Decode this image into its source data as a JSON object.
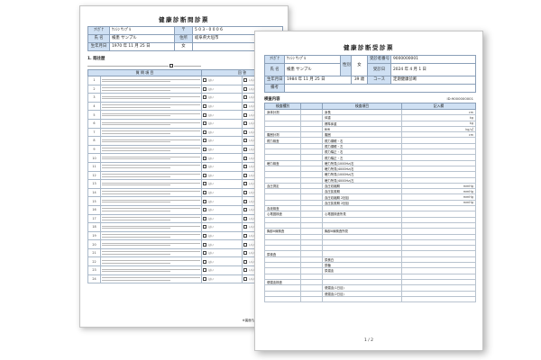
{
  "questionnaire": {
    "title": "健康診断問診票",
    "header": {
      "furigana_label": "ﾌﾘｶﾞﾅ",
      "furigana_value": "ｹﾝｼﾝ ｻﾝﾌﾟﾙ",
      "name_label": "氏 名",
      "name_value": "検患 サンプル",
      "birth_label": "生年月日",
      "birth_value": "1970 年 11 月 25 日",
      "sex_value": "女",
      "address_value": "岐阜県大垣市",
      "number_value": "5 0 3 - 0 0 0 6"
    },
    "section_label": "1. 既往歴",
    "table_headers": {
      "question": "質 問 項 目",
      "answer": "回 答"
    },
    "answer_options": [
      "はい",
      "いいえ"
    ],
    "footer_note": "※裏面も記入してください"
  },
  "results": {
    "title": "健康診断受診票",
    "header": {
      "furigana_label": "ﾌﾘｶﾞﾅ",
      "furigana_value": "ｹﾝｼﾝ ｻﾝﾌﾟﾙ",
      "name_label": "氏 名",
      "name_value": "検患 サンプル",
      "sex_label": "性別",
      "sex_value": "女",
      "birth_label": "生年月日",
      "birth_value": "1984 年 11 月 25 日",
      "age_value": "39 歳",
      "exam_no_label": "受診者番号",
      "exam_no_value": "9000000001",
      "exam_date_label": "受診日",
      "exam_date_value": "2024 年 4 月 1 日",
      "course_label": "コース",
      "course_value": "定期健康診断",
      "notes_label": "備考"
    },
    "section_label": "検査内容",
    "id_right": "ID:9000000001",
    "table_headers": {
      "category": "検査種別",
      "item": "検査項目",
      "result": "記入欄"
    },
    "categories": [
      "身体計測",
      "",
      "",
      "",
      "腹囲計測",
      "視力検査",
      "",
      "",
      "",
      "聴力検査",
      "",
      "",
      "",
      "血圧測定",
      "",
      "",
      "",
      "血液検査",
      "心電図検査",
      "",
      "",
      "胸部X線検査",
      "",
      "",
      "",
      "尿検査",
      "",
      "",
      "",
      "",
      "便潜血検査",
      "",
      "",
      ""
    ],
    "items": [
      "身長",
      "体重",
      "標準体重",
      "BMI",
      "腹囲",
      "視力裸眼・右",
      "視力裸眼・左",
      "視力矯正・右",
      "視力矯正・左",
      "聴力所見(1000Hz)右",
      "聴力所見(4000Hz)右",
      "聴力所見(1000Hz)左",
      "聴力所見(4000Hz)左",
      "血圧収縮期",
      "血圧拡張期",
      "血圧収縮期 2回目",
      "血圧拡張期 2回目",
      "",
      "心電図検査所見",
      "",
      "",
      "胸部X線検査所見",
      "",
      "",
      "",
      "",
      "尿蛋白",
      "尿糖",
      "尿潜血",
      "",
      "",
      "便潜血(1日目)",
      "便潜血(2日目)",
      ""
    ],
    "units": [
      "cm",
      "kg",
      "kg",
      "kg/㎡",
      "cm",
      "",
      "",
      "",
      "",
      "",
      "",
      "",
      "",
      "mmHg",
      "mmHg",
      "mmHg",
      "mmHg",
      "",
      "",
      "",
      "",
      "",
      "",
      "",
      "",
      "",
      "",
      "",
      "",
      "",
      "",
      "",
      "",
      ""
    ],
    "page": "1 / 2"
  }
}
